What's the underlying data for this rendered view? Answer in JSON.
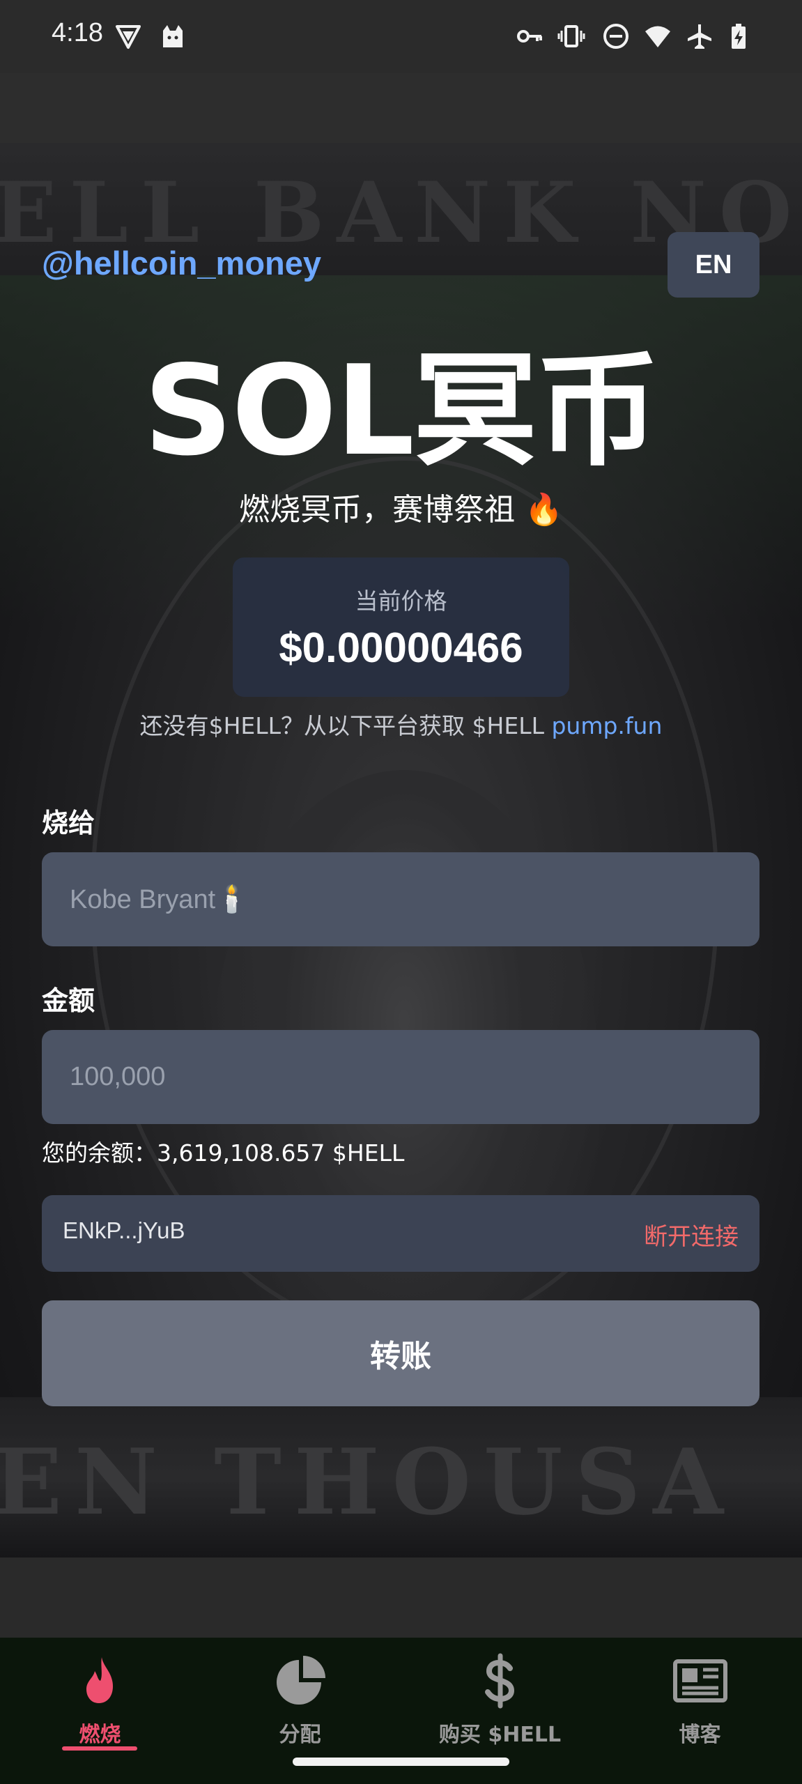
{
  "status_bar": {
    "time": "4:18",
    "left_icons": [
      "vpn-triangle-icon",
      "cat-notification-icon"
    ],
    "right_icons": [
      "key-icon",
      "vibrate-icon",
      "do-not-disturb-icon",
      "wifi-icon",
      "airplane-mode-icon",
      "battery-charging-icon"
    ]
  },
  "header": {
    "twitter_handle": "@hellcoin_money",
    "lang_button": "EN"
  },
  "background": {
    "note_text_top": "ELL BANK NO",
    "note_text_bottom": "EN THOUSA"
  },
  "hero": {
    "title": "SOL冥币",
    "subtitle": "燃烧冥币，赛博祭祖 🔥"
  },
  "price": {
    "label": "当前价格",
    "value": "$0.00000466"
  },
  "get_hell": {
    "text": "还没有$HELL？从以下平台获取 $HELL ",
    "link": "pump.fun"
  },
  "form": {
    "recipient_label": "烧给",
    "recipient_placeholder": "Kobe Bryant🕯️",
    "amount_label": "金额",
    "amount_placeholder": "100,000",
    "balance": "您的余额：3,619,108.657 $HELL"
  },
  "wallet": {
    "address": "ENkP...jYuB",
    "disconnect_label": "断开连接"
  },
  "transfer_button": "转账",
  "bottom_nav": {
    "items": [
      {
        "label": "燃烧",
        "icon": "flame-icon",
        "active": true
      },
      {
        "label": "分配",
        "icon": "pie-chart-icon",
        "active": false
      },
      {
        "label": "购买 $HELL",
        "icon": "dollar-icon",
        "active": false
      },
      {
        "label": "博客",
        "icon": "newspaper-icon",
        "active": false
      }
    ]
  },
  "colors": {
    "accent_link": "#6ea8ff",
    "nav_active": "#ee4f6f",
    "disconnect": "#f26a6a",
    "input_bg": "#4c5465",
    "button_bg": "#6b7180",
    "nav_bg": "#0b160b"
  }
}
